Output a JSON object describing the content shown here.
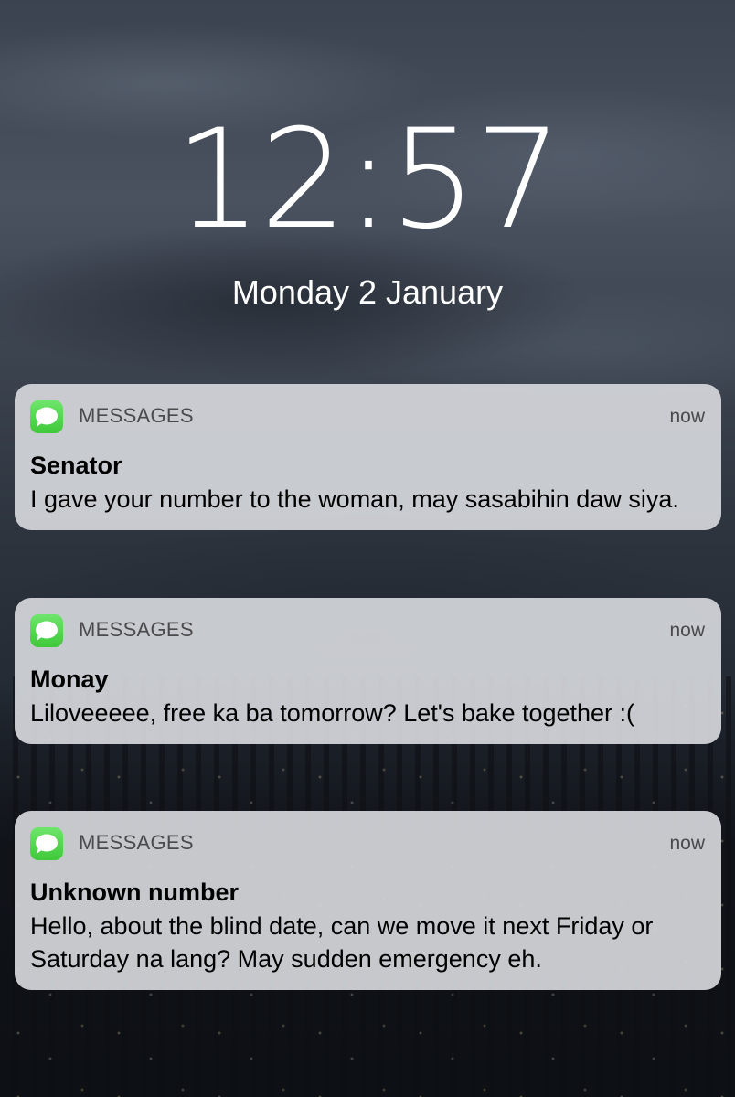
{
  "lockscreen": {
    "time": "12:57",
    "date": "Monday 2 January"
  },
  "notifications": [
    {
      "app": "MESSAGES",
      "time": "now",
      "sender": "Senator",
      "message": "I gave your number to the woman, may sasabihin daw siya.",
      "icon": "messages-app-icon"
    },
    {
      "app": "MESSAGES",
      "time": "now",
      "sender": "Monay",
      "message": "Liloveeeee, free ka ba tomorrow? Let's bake together :(",
      "icon": "messages-app-icon"
    },
    {
      "app": "MESSAGES",
      "time": "now",
      "sender": "Unknown number",
      "message": "Hello, about the blind date, can we move it next Friday or Saturday na lang? May sudden emergency eh.",
      "icon": "messages-app-icon"
    }
  ],
  "colors": {
    "messages_green": "#4cd964",
    "card_background": "#d4d6da"
  }
}
